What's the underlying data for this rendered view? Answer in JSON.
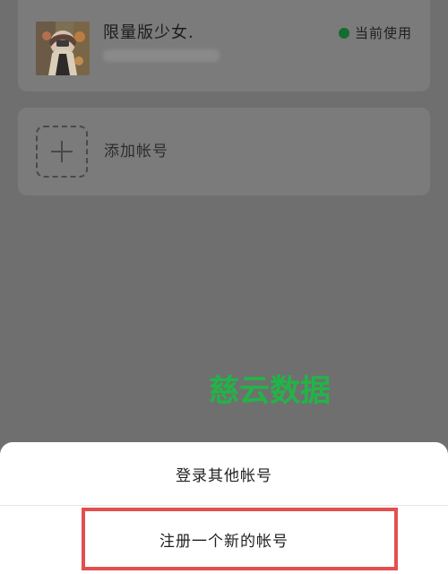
{
  "account": {
    "name": "限量版少女.",
    "status": "当前使用",
    "avatar_icon": "profile-photo-icon"
  },
  "actions": {
    "add_account": "添加帐号",
    "add_icon": "plus-icon"
  },
  "sheet": {
    "login_other": "登录其他帐号",
    "register_new": "注册一个新的帐号"
  },
  "watermark": "慈云数据",
  "colors": {
    "overlay_background": "#6f6f6f",
    "card_background": "#7b7b7b",
    "status_dot": "#146c2e",
    "watermark": "#22b447",
    "highlight": "#e34f4f"
  }
}
